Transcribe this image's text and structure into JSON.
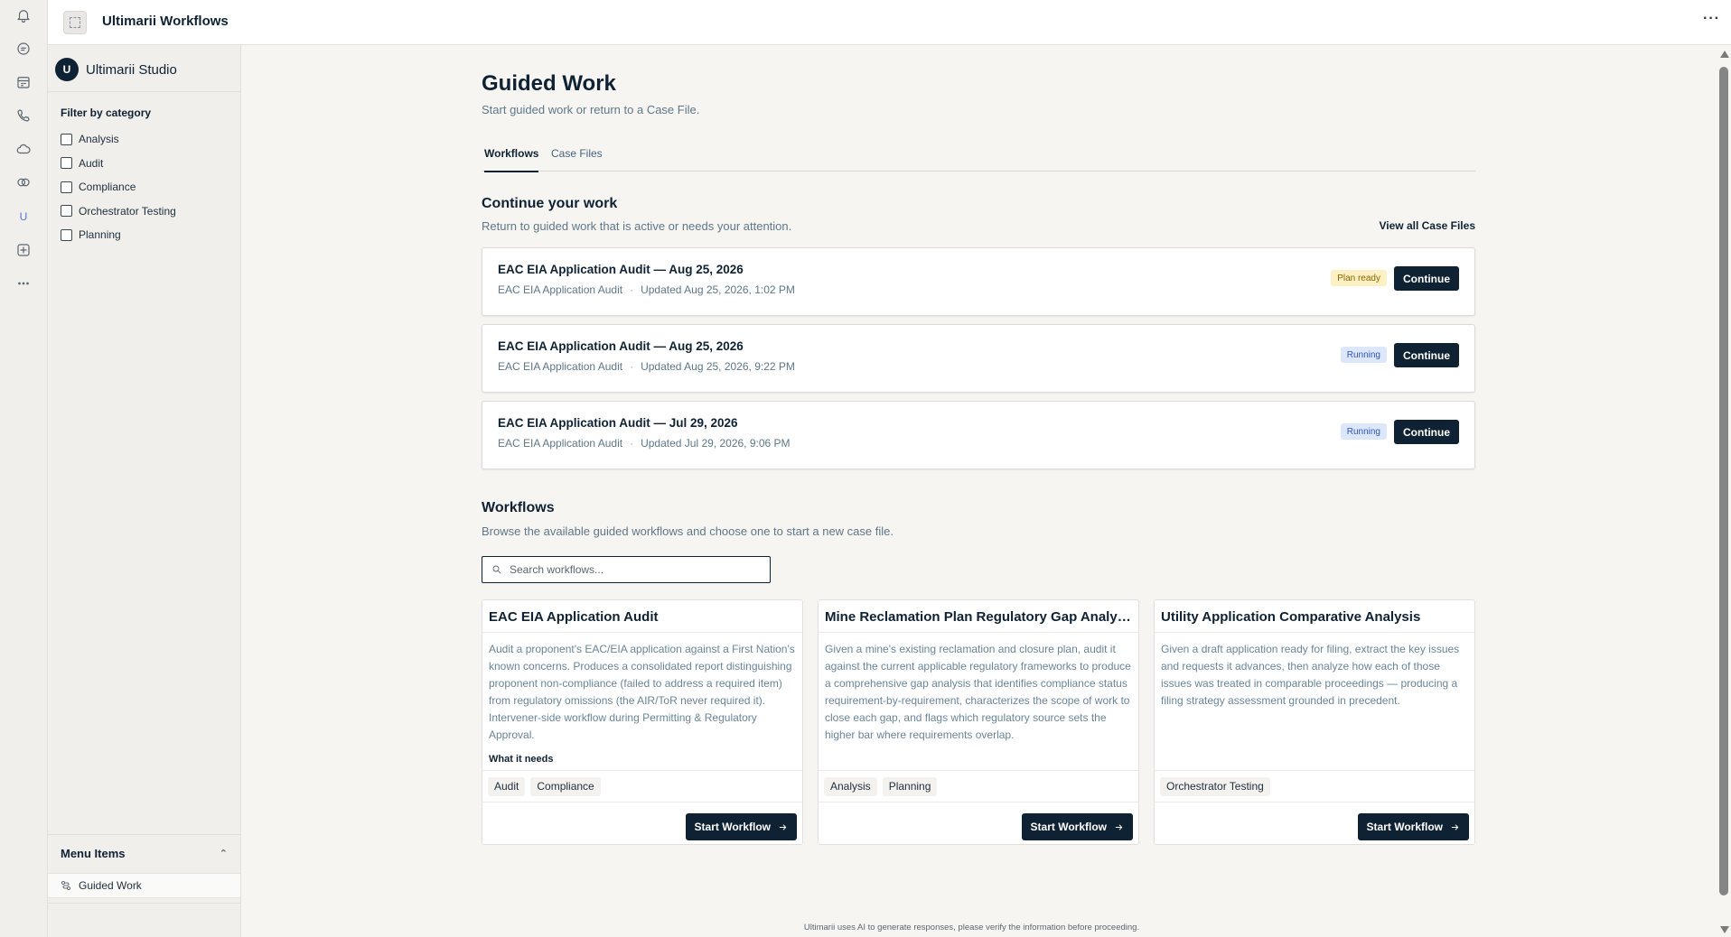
{
  "app": {
    "title": "Ultimarii Workflows",
    "more": "···"
  },
  "rail": {
    "icons": [
      "bell-icon",
      "chat-icon",
      "calendar-icon",
      "phone-icon",
      "cloud-icon",
      "copilot-icon",
      "ultimarii-icon",
      "add-app-icon",
      "more-icon"
    ],
    "ultimarii_glyph": "U"
  },
  "sidebar": {
    "brand_initial": "U",
    "brand_name": "Ultimarii Studio",
    "filter_title": "Filter by category",
    "categories": [
      "Analysis",
      "Audit",
      "Compliance",
      "Orchestrator Testing",
      "Planning"
    ],
    "menu_title": "Menu Items",
    "menu_items": [
      "Guided Work"
    ]
  },
  "page": {
    "title": "Guided Work",
    "subtitle": "Start guided work or return to a Case File.",
    "tabs": [
      "Workflows",
      "Case Files"
    ]
  },
  "continue_section": {
    "title": "Continue your work",
    "subtitle": "Return to guided work that is active or needs your attention.",
    "view_all": "View all Case Files",
    "items": [
      {
        "title": "EAC EIA Application Audit — Aug 25, 2026",
        "workflow": "EAC EIA Application Audit",
        "separator": "·",
        "updated": "Updated Aug 25, 2026, 1:02 PM",
        "status": "Plan ready",
        "action": "Continue"
      },
      {
        "title": "EAC EIA Application Audit — Aug 25, 2026",
        "workflow": "EAC EIA Application Audit",
        "separator": "·",
        "updated": "Updated Aug 25, 2026, 9:22 PM",
        "status": "Running",
        "action": "Continue"
      },
      {
        "title": "EAC EIA Application Audit — Jul 29, 2026",
        "workflow": "EAC EIA Application Audit",
        "separator": "·",
        "updated": "Updated Jul 29, 2026, 9:06 PM",
        "status": "Running",
        "action": "Continue"
      }
    ]
  },
  "workflows_section": {
    "title": "Workflows",
    "subtitle": "Browse the available guided workflows and choose one to start a new case file.",
    "search_placeholder": "Search workflows...",
    "search_value": "",
    "cards": [
      {
        "title": "EAC EIA Application Audit",
        "description": "Audit a proponent's EAC/EIA application against a First Nation's known concerns. Produces a consolidated report distinguishing proponent non-compliance (failed to address a required item) from regulatory omissions (the AIR/ToR never required it). Intervener-side workflow during Permitting & Regulatory Approval.",
        "needs": "What it needs",
        "tags": [
          "Audit",
          "Compliance"
        ],
        "action": "Start Workflow"
      },
      {
        "title": "Mine Reclamation Plan Regulatory Gap Analysis",
        "description": "Given a mine's existing reclamation and closure plan, audit it against the current applicable regulatory frameworks to produce a comprehensive gap analysis that identifies compliance status requirement-by-requirement, characterizes the scope of work to close each gap, and flags which regulatory source sets the higher bar where requirements overlap.",
        "needs": "",
        "tags": [
          "Analysis",
          "Planning"
        ],
        "action": "Start Workflow"
      },
      {
        "title": "Utility Application Comparative Analysis",
        "description": "Given a draft application ready for filing, extract the key issues and requests it advances, then analyze how each of those issues was treated in comparable proceedings — producing a filing strategy assessment grounded in precedent.",
        "needs": "",
        "tags": [
          "Orchestrator Testing"
        ],
        "action": "Start Workflow"
      }
    ]
  },
  "footer": {
    "disclaimer": "Ultimarii uses AI to generate responses, please verify the information before proceeding."
  },
  "colors": {
    "primary": "#0f2233",
    "plan_ready_bg": "#fdf1c4",
    "running_bg": "#dde7fb",
    "muted_text": "#5e7789"
  }
}
